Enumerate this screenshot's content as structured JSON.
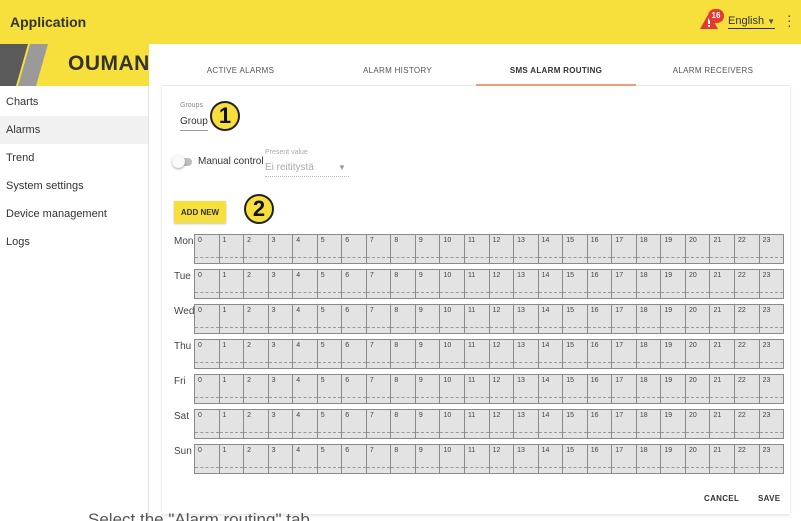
{
  "header": {
    "app_title": "Application",
    "alarm_count": "16",
    "language": "English",
    "brand_color": "#f7e03c"
  },
  "sidebar": {
    "logo": "OUMAN",
    "items": [
      {
        "label": "Charts",
        "active": false
      },
      {
        "label": "Alarms",
        "active": true
      },
      {
        "label": "Trend",
        "active": false
      },
      {
        "label": "System settings",
        "active": false
      },
      {
        "label": "Device management",
        "active": false
      },
      {
        "label": "Logs",
        "active": false
      }
    ]
  },
  "tabs": [
    {
      "label": "ACTIVE ALARMS",
      "active": false
    },
    {
      "label": "ALARM HISTORY",
      "active": false
    },
    {
      "label": "SMS ALARM ROUTING",
      "active": true
    },
    {
      "label": "ALARM RECEIVERS",
      "active": false
    }
  ],
  "groups": {
    "label": "Groups",
    "value": "Group"
  },
  "manual_control": {
    "label": "Manual control",
    "enabled": false
  },
  "present_value": {
    "label": "Present value",
    "value": "Ei reititystä"
  },
  "add_new_label": "ADD NEW",
  "callouts": [
    "1",
    "2"
  ],
  "schedule": {
    "days": [
      "Mon",
      "Tue",
      "Wed",
      "Thu",
      "Fri",
      "Sat",
      "Sun"
    ],
    "hours": [
      "0",
      "1",
      "2",
      "3",
      "4",
      "5",
      "6",
      "7",
      "8",
      "9",
      "10",
      "11",
      "12",
      "13",
      "14",
      "15",
      "16",
      "17",
      "18",
      "19",
      "20",
      "21",
      "22",
      "23"
    ]
  },
  "footer": {
    "cancel_label": "CANCEL",
    "save_label": "SAVE"
  },
  "caption": "Select the \"Alarm routing\" tab."
}
